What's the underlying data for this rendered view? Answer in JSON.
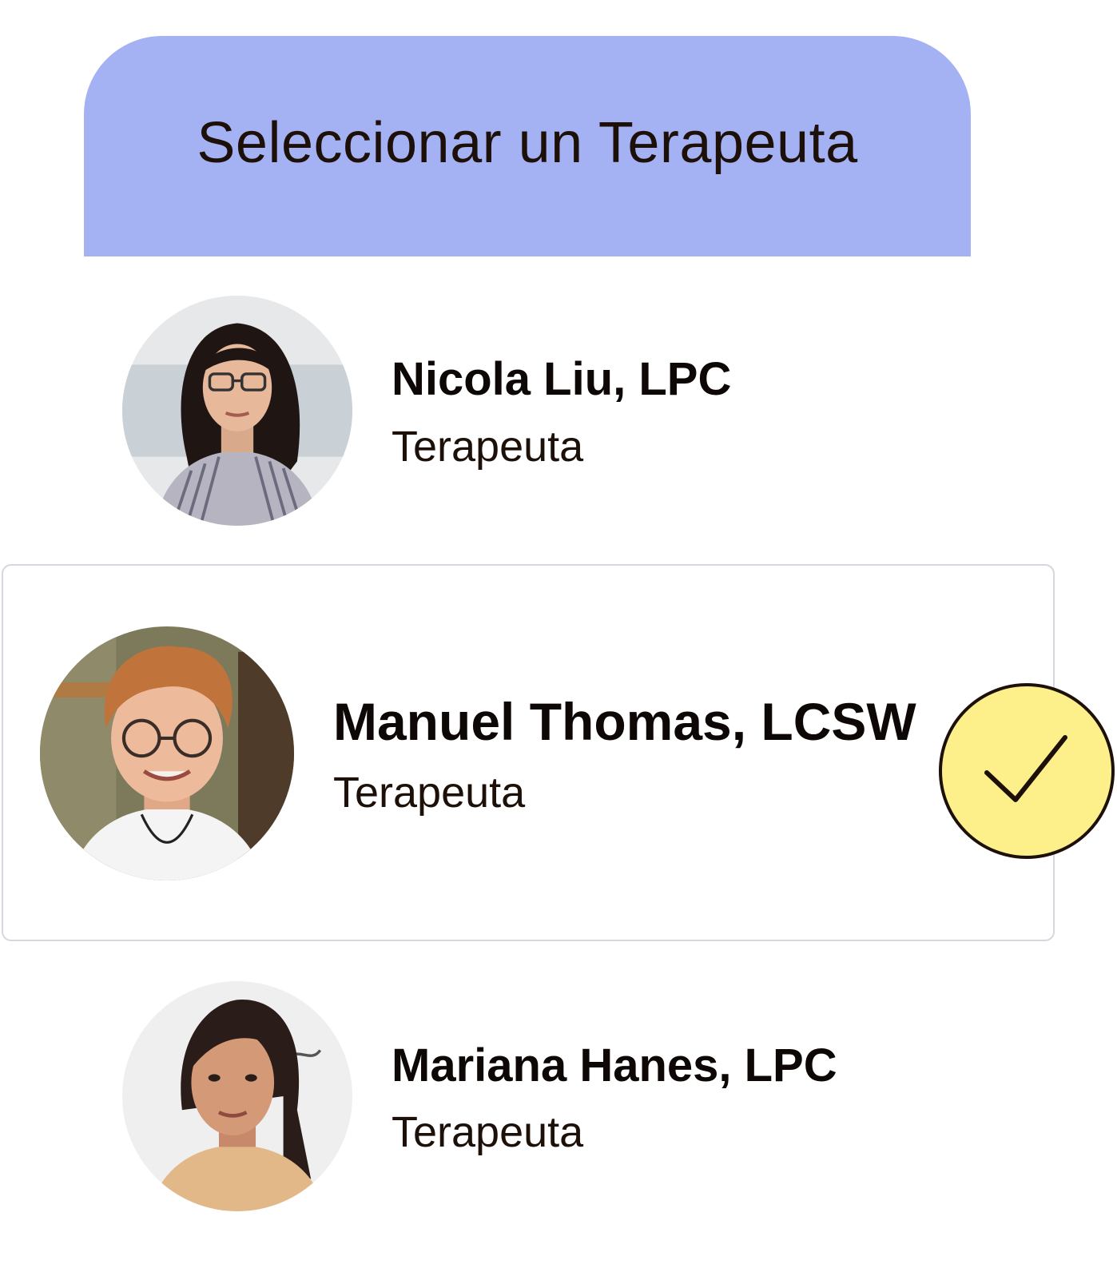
{
  "header": {
    "title": "Seleccionar un Terapeuta",
    "background_color": "#a4b2f3"
  },
  "therapists": [
    {
      "name": "Nicola Liu, LPC",
      "role": "Terapeuta",
      "selected": false,
      "avatar": "avatar-photo-nicola"
    },
    {
      "name": "Manuel Thomas, LCSW",
      "role": "Terapeuta",
      "selected": true,
      "avatar": "avatar-photo-manuel"
    },
    {
      "name": "Mariana Hanes, LPC",
      "role": "Terapeuta",
      "selected": false,
      "avatar": "avatar-photo-mariana"
    }
  ],
  "selection_badge": {
    "icon": "checkmark-icon",
    "color": "#fdf08a"
  }
}
